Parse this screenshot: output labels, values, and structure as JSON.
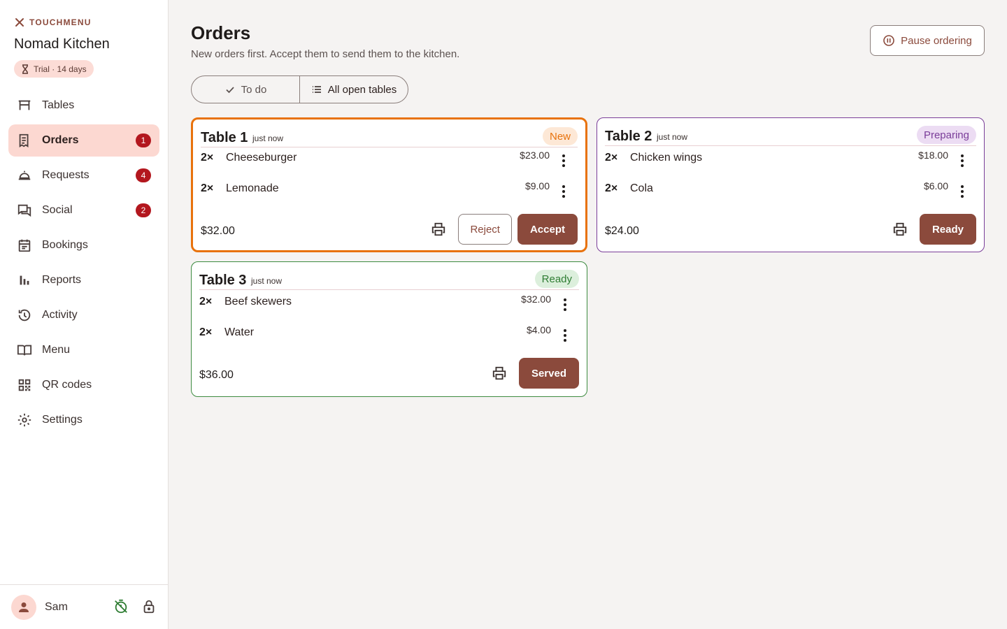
{
  "brand": {
    "name": "TOUCHMENU",
    "icon": "utensils-icon",
    "restaurant": "Nomad Kitchen",
    "trial": "Trial · 14 days"
  },
  "nav": {
    "items": [
      {
        "label": "Tables",
        "icon": "table-icon",
        "badge": ""
      },
      {
        "label": "Orders",
        "icon": "receipt-icon",
        "badge": "1",
        "active": true
      },
      {
        "label": "Requests",
        "icon": "cloche-icon",
        "badge": "4"
      },
      {
        "label": "Social",
        "icon": "chat-icon",
        "badge": "2"
      },
      {
        "label": "Bookings",
        "icon": "calendar-icon",
        "badge": ""
      },
      {
        "label": "Reports",
        "icon": "bar-chart-icon",
        "badge": ""
      },
      {
        "label": "Activity",
        "icon": "history-icon",
        "badge": ""
      },
      {
        "label": "Menu",
        "icon": "book-icon",
        "badge": ""
      },
      {
        "label": "QR codes",
        "icon": "qr-code-icon",
        "badge": ""
      },
      {
        "label": "Settings",
        "icon": "gear-icon",
        "badge": ""
      }
    ]
  },
  "user": {
    "name": "Sam"
  },
  "header": {
    "title": "Orders",
    "subtitle": "New orders first. Accept them to send them to the kitchen.",
    "pause_label": "Pause ordering"
  },
  "filters": {
    "todo_label": "To do",
    "all_label": "All open tables"
  },
  "orders": [
    {
      "table": "Table 1",
      "time": "just now",
      "status": "New",
      "items": [
        {
          "qty": "2×",
          "name": "Cheeseburger",
          "price": "$23.00"
        },
        {
          "qty": "2×",
          "name": "Lemonade",
          "price": "$9.00"
        }
      ],
      "total": "$32.00",
      "reject_label": "Reject",
      "action_label": "Accept"
    },
    {
      "table": "Table 2",
      "time": "just now",
      "status": "Preparing",
      "items": [
        {
          "qty": "2×",
          "name": "Chicken wings",
          "price": "$18.00"
        },
        {
          "qty": "2×",
          "name": "Cola",
          "price": "$6.00"
        }
      ],
      "total": "$24.00",
      "action_label": "Ready"
    },
    {
      "table": "Table 3",
      "time": "just now",
      "status": "Ready",
      "items": [
        {
          "qty": "2×",
          "name": "Beef skewers",
          "price": "$32.00"
        },
        {
          "qty": "2×",
          "name": "Water",
          "price": "$4.00"
        }
      ],
      "total": "$36.00",
      "action_label": "Served"
    }
  ],
  "colors": {
    "accent": "#8b4a3c",
    "new": "#e8720c",
    "preparing": "#7a3d99",
    "ready": "#3d8b40",
    "badge": "#b3171e",
    "active_nav": "#fcd8d1"
  }
}
